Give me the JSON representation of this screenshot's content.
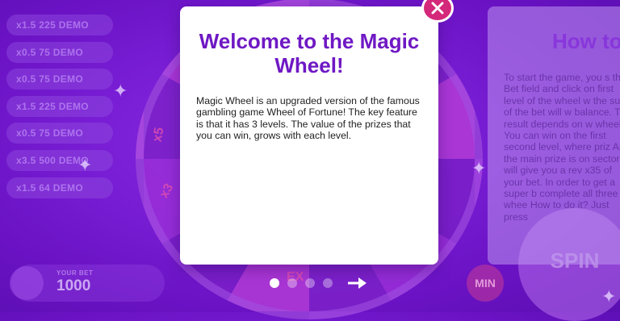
{
  "history": [
    "x1.5  225 DEMO",
    "x0.5  75 DEMO",
    "x0.5  75 DEMO",
    "x1.5  225 DEMO",
    "x0.5  75 DEMO",
    "x3.5  500 DEMO",
    "x1.5  64 DEMO"
  ],
  "wheel": {
    "labels": [
      "x5",
      "x3",
      "EX"
    ]
  },
  "bet": {
    "caption": "YOUR BET",
    "value": "1000",
    "minus_icon": "minus-icon"
  },
  "buttons": {
    "min": "MIN",
    "spin": "SPIN"
  },
  "modal": {
    "title": "Welcome to the Magic Wheel!",
    "body": "Magic Wheel is an upgraded version of the famous gambling game Wheel of Fortune! The key feature is that it has 3 levels. The value of the prizes that you can win, grows with each level.",
    "close_icon": "close-icon",
    "close_color": "#d4287a",
    "title_color": "#6f18c4"
  },
  "next_card": {
    "title": "How to",
    "body": "To start the game, you s the Bet field and click on first level of the wheel w the sum of the bet will w balance. The result depends on w wheel. You can win on the first second level, where priz And the main prize is on sector will give you a rev x35 of your bet. In order to get a super b complete all three whee How to do it? Just press"
  },
  "pager": {
    "pages": 4,
    "current": 1,
    "next_icon": "arrow-right-icon"
  }
}
